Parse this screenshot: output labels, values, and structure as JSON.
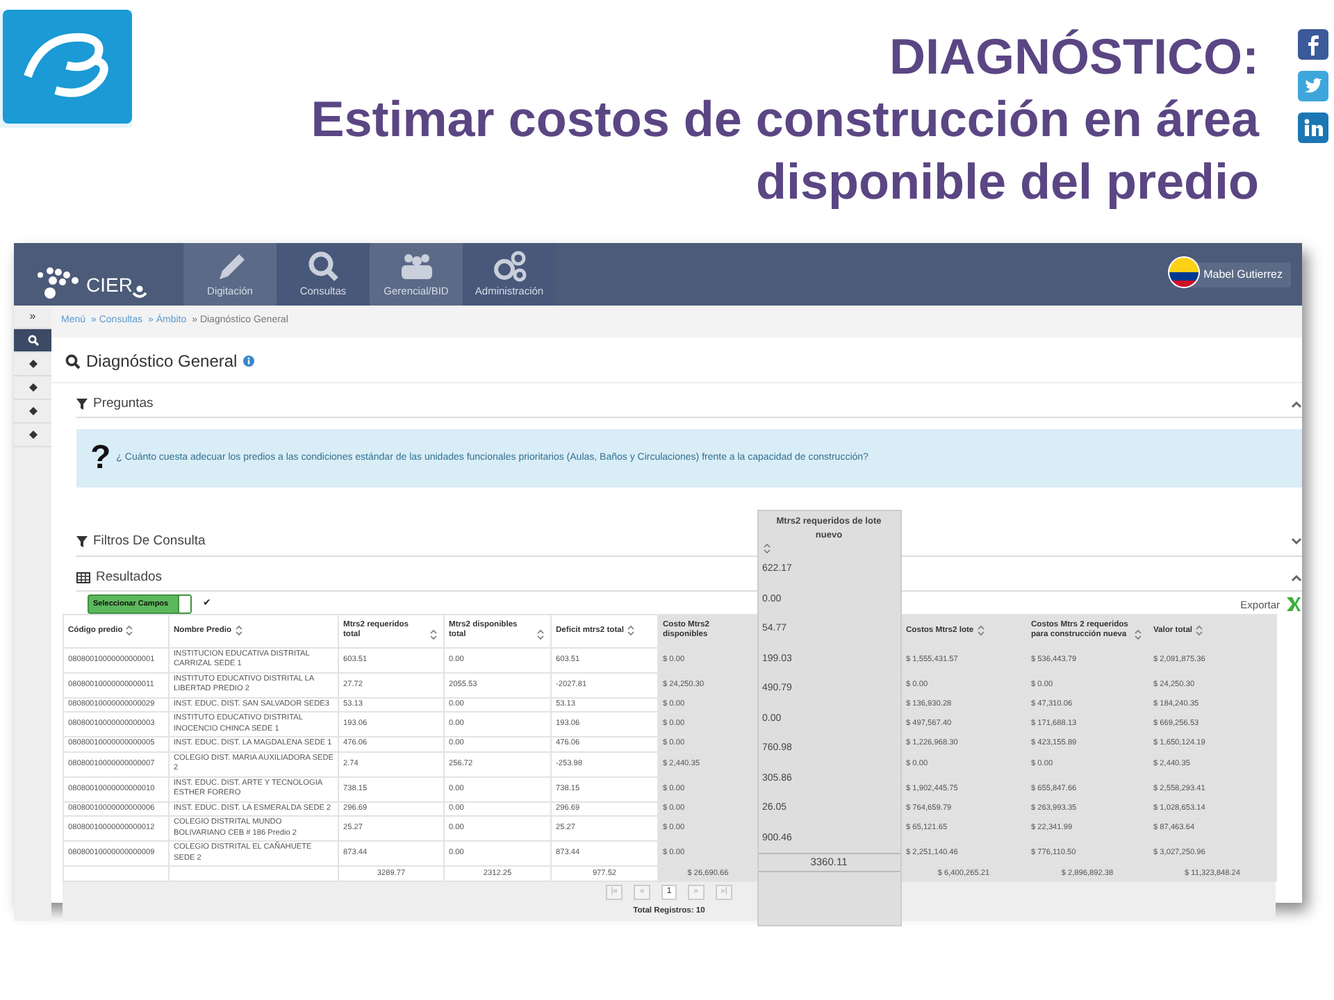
{
  "slide": {
    "title_lines": [
      "DIAGNÓSTICO:",
      "Estimar costos de construcción en área",
      "disponible del predio"
    ]
  },
  "app": {
    "navbar": {
      "brand": "CIER",
      "items": [
        {
          "label": "Digitación"
        },
        {
          "label": "Consultas"
        },
        {
          "label": "Gerencial/BID"
        },
        {
          "label": "Administración"
        }
      ],
      "user": "Mabel Gutierrez"
    },
    "sidebar": {
      "toggle": "»",
      "items": [
        {
          "selected": true
        },
        {
          "selected": false
        },
        {
          "selected": false
        },
        {
          "selected": false
        },
        {
          "selected": false
        }
      ]
    },
    "breadcrumb": [
      "Menú",
      "» Consultas",
      "» Ámbito",
      "» Diagnóstico General"
    ],
    "page_title": "Diagnóstico General",
    "preguntas": {
      "title": "Preguntas",
      "expanded": true,
      "mark": "?",
      "question": "¿ Cuánto cuesta adecuar los predios a las condiciones estándar de las unidades funcionales prioritarios (Aulas, Baños y Circulaciones) frente a la capacidad de construcción?"
    },
    "filtros": {
      "title": "Filtros De Consulta",
      "expanded": false
    },
    "resultados": {
      "title": "Resultados",
      "expanded": true,
      "select_button": "Seleccionar Campos",
      "check": "✔",
      "export": "Exportar"
    },
    "table": {
      "columns": [
        {
          "label": "Código predio",
          "sortable": true
        },
        {
          "label": "Nombre Predio",
          "sortable": true
        },
        {
          "label": "Mtrs2 requeridos total",
          "sortable": true
        },
        {
          "label": "Mtrs2 disponibles total",
          "sortable": true
        },
        {
          "label": "Deficit mtrs2 total",
          "sortable": true
        },
        {
          "label": "Costo Mtrs2 disponibles",
          "sortable": false
        },
        {
          "label": "Costos Mtrs2 lote",
          "sortable": true
        },
        {
          "label": "Costos Mtrs 2 requeridos para construcción nueva",
          "sortable": true
        },
        {
          "label": "Valor total",
          "sortable": true
        }
      ],
      "rows": [
        [
          "08080010000000000001",
          "INSTITUCION EDUCATIVA DISTRITAL CARRIZAL SEDE 1",
          "603.51",
          "0.00",
          "603.51",
          "$ 0.00",
          "$ 1,555,431.57",
          "$ 536,443.79",
          "$ 2,091,875.36"
        ],
        [
          "08080010000000000011",
          "INSTITUTO EDUCATIVO DISTRITAL LA LIBERTAD PREDIO 2",
          "27.72",
          "2055.53",
          "-2027.81",
          "$ 24,250.30",
          "$ 0.00",
          "$ 0.00",
          "$ 24,250.30"
        ],
        [
          "08080010000000000029",
          "INST. EDUC. DIST. SAN SALVADOR SEDE3",
          "53.13",
          "0.00",
          "53.13",
          "$ 0.00",
          "$ 136,930.28",
          "$ 47,310.06",
          "$ 184,240.35"
        ],
        [
          "08080010000000000003",
          "INSTITUTO EDUCATIVO DISTRITAL INOCENCIO CHINCA SEDE 1",
          "193.06",
          "0.00",
          "193.06",
          "$ 0.00",
          "$ 497,567.40",
          "$ 171,688.13",
          "$ 669,256.53"
        ],
        [
          "08080010000000000005",
          "INST. EDUC. DIST. LA MAGDALENA SEDE 1",
          "476.06",
          "0.00",
          "476.06",
          "$ 0.00",
          "$ 1,226,968.30",
          "$ 423,155.89",
          "$ 1,650,124.19"
        ],
        [
          "08080010000000000007",
          "COLEGIO DIST. MARIA AUXILIADORA SEDE 2",
          "2.74",
          "256.72",
          "-253.98",
          "$ 2,440.35",
          "$ 0.00",
          "$ 0.00",
          "$ 2,440.35"
        ],
        [
          "08080010000000000010",
          "INST. EDUC. DIST. ARTE Y TECNOLOGIA ESTHER FORERO",
          "738.15",
          "0.00",
          "738.15",
          "$ 0.00",
          "$ 1,902,445.75",
          "$ 655,847.66",
          "$ 2,558,293.41"
        ],
        [
          "08080010000000000006",
          "INST. EDUC. DIST. LA ESMERALDA SEDE 2",
          "296.69",
          "0.00",
          "296.69",
          "$ 0.00",
          "$ 764,659.79",
          "$ 263,993.35",
          "$ 1,028,653.14"
        ],
        [
          "08080010000000000012",
          "COLEGIO DISTRITAL MUNDO BOLIVARIANO CEB # 186 Predio 2",
          "25.27",
          "0.00",
          "25.27",
          "$ 0.00",
          "$ 65,121.65",
          "$ 22,341.99",
          "$ 87,463.64"
        ],
        [
          "08080010000000000009",
          "COLEGIO DISTRITAL EL CAÑAHUETE SEDE 2",
          "873.44",
          "0.00",
          "873.44",
          "$ 0.00",
          "$ 2,251,140.46",
          "$ 776,110.50",
          "$ 3,027,250.96"
        ]
      ],
      "totals": [
        "3289.77",
        "2312.25",
        "977.52",
        "$ 26,690.66",
        "$ 6,400,265.21",
        "$ 2,896,892.38",
        "$ 11,323,848.24"
      ]
    },
    "floating_column": {
      "label": "Mtrs2 requeridos de lote nuevo",
      "values": [
        "622.17",
        "0.00",
        "54.77",
        "199.03",
        "490.79",
        "0.00",
        "760.98",
        "305.86",
        "26.05",
        "900.46"
      ],
      "total": "3360.11"
    },
    "pagination": [
      {
        "label": "|«",
        "selected": false
      },
      {
        "label": "«",
        "selected": false
      },
      {
        "label": "1",
        "selected": true
      },
      {
        "label": "»",
        "selected": false
      },
      {
        "label": "»|",
        "selected": false
      }
    ],
    "total_records": "Total Registros: 10"
  }
}
